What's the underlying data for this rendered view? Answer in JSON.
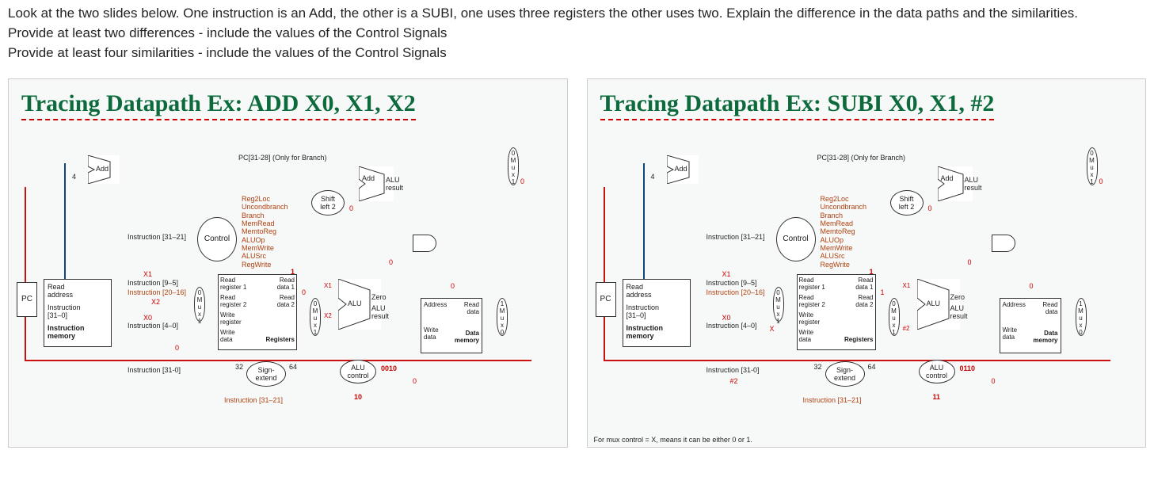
{
  "prompt": {
    "l1": "Look at the two slides below. One instruction is an Add, the other is a SUBI, one uses three registers the other uses two. Explain the difference in the data paths and the similarities.",
    "l2": "Provide at least two differences - include the values of the Control Signals",
    "l3": "Provide at least four similarities - include the values of the Control Signals"
  },
  "slides": {
    "left": {
      "title": "Tracing Datapath Ex: ADD X0, X1, X2",
      "pc": "PC",
      "instr_mem_a": "Read",
      "instr_mem_b": "address",
      "instr_mem_c": "Instruction",
      "instr_mem_d": "[31–0]",
      "instr_mem_e": "Instruction",
      "instr_mem_f": "memory",
      "add1": "Add",
      "pc_only": "PC[31-28] (Only for Branch)",
      "four": "4",
      "inst_31_21": "Instruction [31–21]",
      "inst_9_5": "Instruction [9–5]",
      "inst_20_16": "Instruction [20–16]",
      "inst_4_0": "Instruction [4–0]",
      "inst_31_0": "Instruction [31-0]",
      "inst_31_21b": "Instruction [31–21]",
      "x1": "X1",
      "x2": "X2",
      "x0": "X0",
      "zero_path": "0",
      "control": "Control",
      "ctrl_signals": [
        "Reg2Loc",
        "Uncondbranch",
        "Branch",
        "MemRead",
        "MemtoReg",
        "ALUOp",
        "MemWrite",
        "ALUSrc",
        "RegWrite"
      ],
      "reg_r1": "Read",
      "reg_r1b": "register 1",
      "reg_r2": "Read",
      "reg_r2b": "register 2",
      "reg_w": "Write",
      "reg_wb": "register",
      "reg_wd": "Write",
      "reg_wdb": "data",
      "reg_title": "Registers",
      "reg_rd1": "Read",
      "reg_rd1b": "data 1",
      "reg_rd2": "Read",
      "reg_rd2b": "data 2",
      "sign": "Sign-",
      "sign2": "extend",
      "s32": "32",
      "s64": "64",
      "shift": "Shift",
      "shift2": "left 2",
      "add2": "Add",
      "alu_r": "ALU",
      "alu_r2": "result",
      "alu": "ALU",
      "alu2": "ALU",
      "alu3": "result",
      "zero": "Zero",
      "aluctrl": "ALU",
      "aluctrl2": "control",
      "alu_op_val": "0010",
      "alu_ctrl_in": "10",
      "mem_a": "Address",
      "mem_r": "Read",
      "mem_rb": "data",
      "mem_w": "Write",
      "mem_wb": "data",
      "mem_t": "Data",
      "mem_t2": "memory",
      "mux": "M",
      "mux2": "u",
      "mux3": "x",
      "m0": "0",
      "m1": "1",
      "sig0a": "0",
      "sig0b": "0",
      "sig0c": "0",
      "sig0d": "0",
      "sig0e": "0",
      "sig0f": "0",
      "sig1": "1",
      "regwrite1": "1",
      "mux_x2": "X2",
      "x1_red": "X1"
    },
    "right": {
      "title": "Tracing Datapath Ex: SUBI X0, X1, #2",
      "pc": "PC",
      "instr_mem_a": "Read",
      "instr_mem_b": "address",
      "instr_mem_c": "Instruction",
      "instr_mem_d": "[31–0]",
      "instr_mem_e": "Instruction",
      "instr_mem_f": "memory",
      "add1": "Add",
      "pc_only": "PC[31-28] (Only for Branch)",
      "four": "4",
      "inst_31_21": "Instruction [31–21]",
      "inst_9_5": "Instruction [9–5]",
      "inst_20_16": "Instruction [20–16]",
      "inst_4_0": "Instruction [4–0]",
      "inst_31_0": "Instruction [31-0]",
      "inst_31_21b": "Instruction [31–21]",
      "x1": "X1",
      "x0": "X0",
      "hash2": "#2",
      "x_val": "X",
      "control": "Control",
      "ctrl_signals": [
        "Reg2Loc",
        "Uncondbranch",
        "Branch",
        "MemRead",
        "MemtoReg",
        "ALUOp",
        "MemWrite",
        "ALUSrc",
        "RegWrite"
      ],
      "reg_r1": "Read",
      "reg_r1b": "register 1",
      "reg_r2": "Read",
      "reg_r2b": "register 2",
      "reg_w": "Write",
      "reg_wb": "register",
      "reg_wd": "Write",
      "reg_wdb": "data",
      "reg_title": "Registers",
      "reg_rd1": "Read",
      "reg_rd1b": "data 1",
      "reg_rd2": "Read",
      "reg_rd2b": "data 2",
      "sign": "Sign-",
      "sign2": "extend",
      "s32": "32",
      "s64": "64",
      "shift": "Shift",
      "shift2": "left 2",
      "add2": "Add",
      "alu_r": "ALU",
      "alu_r2": "result",
      "alu": "ALU",
      "alu2": "ALU",
      "alu3": "result",
      "zero": "Zero",
      "aluctrl": "ALU",
      "aluctrl2": "control",
      "alu_op_val": "0110",
      "alu_ctrl_in": "11",
      "mem_a": "Address",
      "mem_r": "Read",
      "mem_rb": "data",
      "mem_w": "Write",
      "mem_wb": "data",
      "mem_t": "Data",
      "mem_t2": "memory",
      "mux": "M",
      "mux2": "u",
      "mux3": "x",
      "m0": "0",
      "m1": "1",
      "sig0a": "0",
      "sig0b": "0",
      "sig0c": "0",
      "sig0d": "0",
      "sig0e": "0",
      "sig0f": "0",
      "sig1": "1",
      "regwrite1": "1",
      "x1_red": "X1",
      "mux_hash2": "#2",
      "footnote": "For mux control = X, means it can be either 0 or 1."
    }
  }
}
